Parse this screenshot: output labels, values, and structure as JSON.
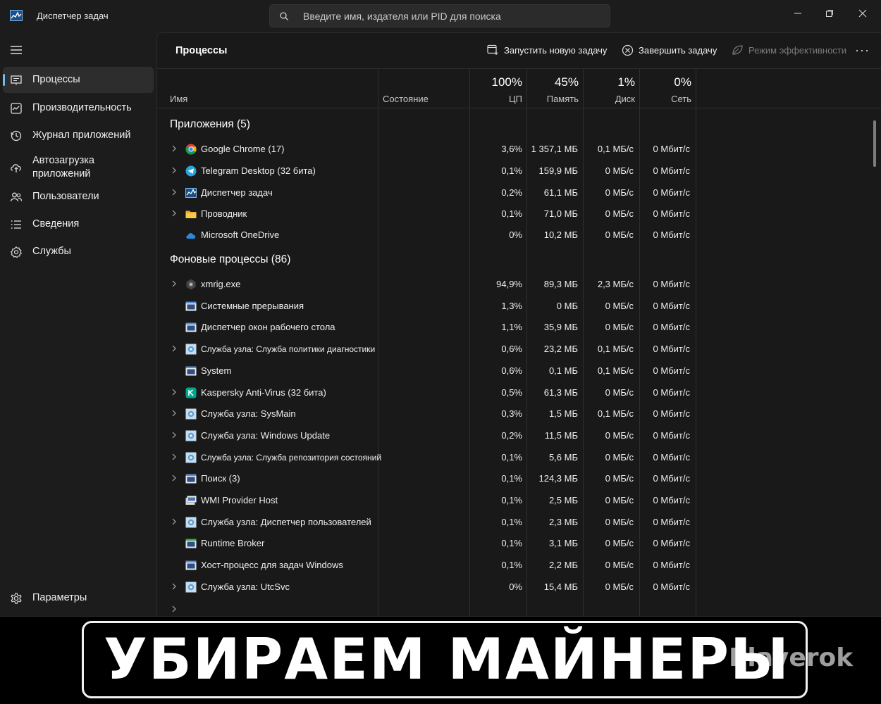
{
  "window": {
    "title": "Диспетчер задач"
  },
  "search": {
    "placeholder": "Введите имя, издателя или PID для поиска"
  },
  "nav": {
    "items": [
      {
        "label": "Процессы",
        "icon": "processes-icon",
        "active": true
      },
      {
        "label": "Производительность",
        "icon": "performance-icon"
      },
      {
        "label": "Журнал приложений",
        "icon": "history-icon"
      },
      {
        "label": "Автозагрузка\nприложений",
        "icon": "startup-icon"
      },
      {
        "label": "Пользователи",
        "icon": "users-icon"
      },
      {
        "label": "Сведения",
        "icon": "details-icon"
      },
      {
        "label": "Службы",
        "icon": "services-icon"
      }
    ],
    "settings_label": "Параметры"
  },
  "main": {
    "title": "Процессы",
    "toolbar": {
      "run_task": "Запустить новую задачу",
      "end_task": "Завершить задачу",
      "efficiency": "Режим эффективности"
    }
  },
  "columns": {
    "name": "Имя",
    "state": "Состояние",
    "cpu": {
      "pct": "100%",
      "label": "ЦП"
    },
    "mem": {
      "pct": "45%",
      "label": "Память"
    },
    "disk": {
      "pct": "1%",
      "label": "Диск"
    },
    "net": {
      "pct": "0%",
      "label": "Сеть"
    }
  },
  "groups": {
    "apps": "Приложения (5)",
    "background": "Фоновые процессы (86)"
  },
  "apps": [
    {
      "name": "Google Chrome (17)",
      "cpu": "3,6%",
      "mem": "1 357,1 МБ",
      "disk": "0,1 МБ/с",
      "net": "0 Мбит/с",
      "icon": "chrome-icon",
      "expand": true
    },
    {
      "name": "Telegram Desktop (32 бита)",
      "cpu": "0,1%",
      "mem": "159,9 МБ",
      "disk": "0 МБ/с",
      "net": "0 Мбит/с",
      "icon": "telegram-icon",
      "expand": true
    },
    {
      "name": "Диспетчер задач",
      "cpu": "0,2%",
      "mem": "61,1 МБ",
      "disk": "0 МБ/с",
      "net": "0 Мбит/с",
      "icon": "taskmgr-icon",
      "expand": true
    },
    {
      "name": "Проводник",
      "cpu": "0,1%",
      "mem": "71,0 МБ",
      "disk": "0 МБ/с",
      "net": "0 Мбит/с",
      "icon": "folder-icon",
      "expand": true
    },
    {
      "name": "Microsoft OneDrive",
      "cpu": "0%",
      "mem": "10,2 МБ",
      "disk": "0 МБ/с",
      "net": "0 Мбит/с",
      "icon": "onedrive-icon",
      "expand": false
    }
  ],
  "background": [
    {
      "name": "xmrig.exe",
      "cpu": "94,9%",
      "mem": "89,3 МБ",
      "disk": "2,3 МБ/с",
      "net": "0 Мбит/с",
      "icon": "xmrig-icon",
      "expand": true
    },
    {
      "name": "Системные прерывания",
      "cpu": "1,3%",
      "mem": "0 МБ",
      "disk": "0 МБ/с",
      "net": "0 Мбит/с",
      "icon": "system-window-icon",
      "expand": false
    },
    {
      "name": "Диспетчер окон рабочего стола",
      "cpu": "1,1%",
      "mem": "35,9 МБ",
      "disk": "0 МБ/с",
      "net": "0 Мбит/с",
      "icon": "system-window-icon",
      "expand": false
    },
    {
      "name": "Служба узла: Служба политики диагностики",
      "cpu": "0,6%",
      "mem": "23,2 МБ",
      "disk": "0,1 МБ/с",
      "net": "0 Мбит/с",
      "icon": "service-host-icon",
      "expand": true,
      "small": true
    },
    {
      "name": "System",
      "cpu": "0,6%",
      "mem": "0,1 МБ",
      "disk": "0,1 МБ/с",
      "net": "0 Мбит/с",
      "icon": "system-window-icon",
      "expand": false
    },
    {
      "name": "Kaspersky Anti-Virus (32 бита)",
      "cpu": "0,5%",
      "mem": "61,3 МБ",
      "disk": "0 МБ/с",
      "net": "0 Мбит/с",
      "icon": "kaspersky-icon",
      "expand": true
    },
    {
      "name": "Служба узла: SysMain",
      "cpu": "0,3%",
      "mem": "1,5 МБ",
      "disk": "0,1 МБ/с",
      "net": "0 Мбит/с",
      "icon": "service-host-icon",
      "expand": true
    },
    {
      "name": "Служба узла: Windows Update",
      "cpu": "0,2%",
      "mem": "11,5 МБ",
      "disk": "0 МБ/с",
      "net": "0 Мбит/с",
      "icon": "service-host-icon",
      "expand": true
    },
    {
      "name": "Служба узла: Служба репозитория состояний",
      "cpu": "0,1%",
      "mem": "5,6 МБ",
      "disk": "0 МБ/с",
      "net": "0 Мбит/с",
      "icon": "service-host-icon",
      "expand": true,
      "small": true
    },
    {
      "name": "Поиск (3)",
      "cpu": "0,1%",
      "mem": "124,3 МБ",
      "disk": "0 МБ/с",
      "net": "0 Мбит/с",
      "icon": "system-window-icon",
      "expand": true
    },
    {
      "name": "WMI Provider Host",
      "cpu": "0,1%",
      "mem": "2,5 МБ",
      "disk": "0 МБ/с",
      "net": "0 Мбит/с",
      "icon": "wmi-icon",
      "expand": false
    },
    {
      "name": "Служба узла: Диспетчер пользователей",
      "cpu": "0,1%",
      "mem": "2,3 МБ",
      "disk": "0 МБ/с",
      "net": "0 Мбит/с",
      "icon": "service-host-icon",
      "expand": true
    },
    {
      "name": "Runtime Broker",
      "cpu": "0,1%",
      "mem": "3,1 МБ",
      "disk": "0 МБ/с",
      "net": "0 Мбит/с",
      "icon": "runtime-broker-icon",
      "expand": false
    },
    {
      "name": "Хост-процесс для задач Windows",
      "cpu": "0,1%",
      "mem": "2,2 МБ",
      "disk": "0 МБ/с",
      "net": "0 Мбит/с",
      "icon": "system-window-icon",
      "expand": false
    },
    {
      "name": "Служба узла: UtcSvc",
      "cpu": "0%",
      "mem": "15,4 МБ",
      "disk": "0 МБ/с",
      "net": "0 Мбит/с",
      "icon": "service-host-icon",
      "expand": true
    }
  ],
  "banner": {
    "text": "УБИРАЕМ МАЙНЕРЫ",
    "watermark": "Playerok"
  },
  "colors": {
    "accent": "#76b9ed",
    "background": "#191919",
    "sidebar": "#1c1c1c"
  }
}
